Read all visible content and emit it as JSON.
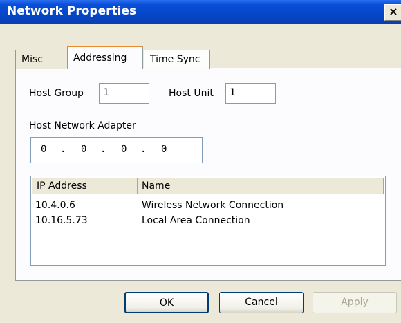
{
  "window": {
    "title": "Network Properties",
    "close_label": "×"
  },
  "tabs": [
    {
      "label": "Misc"
    },
    {
      "label": "Addressing"
    },
    {
      "label": "Time Sync"
    }
  ],
  "addressing": {
    "host_group_label": "Host Group",
    "host_group_value": "1",
    "host_unit_label": "Host Unit",
    "host_unit_value": "1",
    "adapter_label": "Host Network Adapter",
    "adapter_octets": [
      "0",
      "0",
      "0",
      "0"
    ],
    "adapter_dot": "."
  },
  "list": {
    "columns": [
      "IP Address",
      "Name"
    ],
    "rows": [
      {
        "ip": "10.4.0.6",
        "name": "Wireless Network Connection"
      },
      {
        "ip": "10.16.5.73",
        "name": "Local Area Connection"
      }
    ]
  },
  "buttons": {
    "ok": "OK",
    "cancel": "Cancel",
    "apply": "Apply"
  },
  "colors": {
    "titlebar": "#0a4fd8",
    "active_tab_accent": "#e68b2c"
  }
}
